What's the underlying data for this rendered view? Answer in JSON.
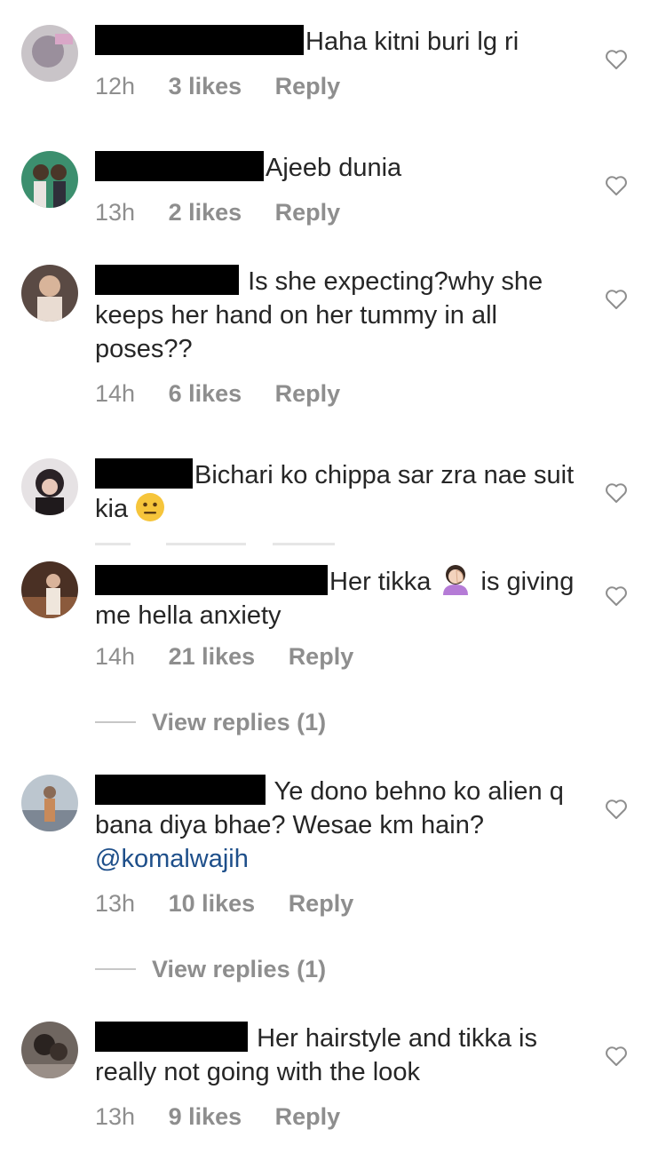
{
  "comments": [
    {
      "text": "Haha kitni buri lg ri",
      "time": "12h",
      "likes": "3 likes",
      "reply": "Reply"
    },
    {
      "text": "Ajeeb dunia",
      "time": "13h",
      "likes": "2 likes",
      "reply": "Reply"
    },
    {
      "text": "Is she expecting?why she keeps her hand on her tummy in all poses??",
      "time": "14h",
      "likes": "6 likes",
      "reply": "Reply"
    },
    {
      "text": "Bichari ko chippa sar zra nae suit kia",
      "emoji": "neutral-face-emoji"
    },
    {
      "text_before": "Her tikka",
      "text_after": "is giving me hella anxiety",
      "emoji": "face-palm-emoji",
      "time": "14h",
      "likes": "21 likes",
      "reply": "Reply",
      "view_replies": "View replies (1)"
    },
    {
      "text": "Ye dono behno ko alien q bana diya bhae? Wesae km hain?",
      "mention": "@komalwajih",
      "time": "13h",
      "likes": "10 likes",
      "reply": "Reply",
      "view_replies": "View replies (1)"
    },
    {
      "text": "Her hairstyle and tikka is really not going with the look",
      "time": "13h",
      "likes": "9 likes",
      "reply": "Reply"
    }
  ],
  "icons": {
    "like": "heart-outline-icon"
  },
  "colors": {
    "text": "#262626",
    "meta": "#8e8e8e",
    "mention": "#1e4f8a",
    "redaction": "#000000"
  }
}
